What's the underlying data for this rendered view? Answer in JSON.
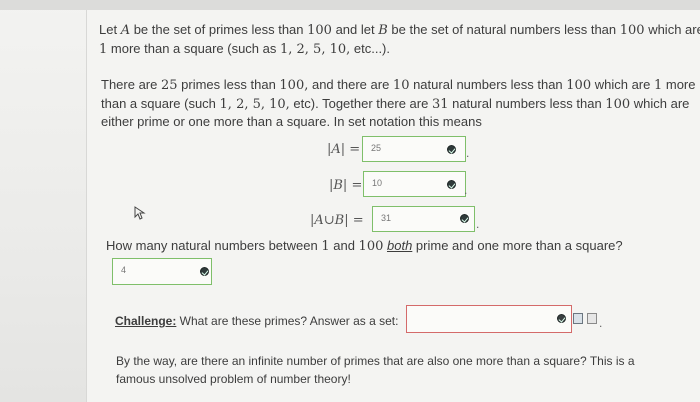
{
  "intro": {
    "line1_a": "Let ",
    "line1_A": "A",
    "line1_b": " be the set of primes less than ",
    "line1_100": "100",
    "line1_c": " and let ",
    "line1_B": "B",
    "line1_d": " be the set of natural numbers less than ",
    "line1_100b": "100",
    "line1_e": " which are",
    "line2_a": "1",
    "line2_b": " more than a square (such as ",
    "line2_list": "1, 2, 5, 10,",
    "line2_c": " etc...)."
  },
  "para": {
    "l1_a": "There are ",
    "l1_25": "25",
    "l1_b": " primes less than ",
    "l1_100": "100,",
    "l1_c": " and there are ",
    "l1_10": "10",
    "l1_d": " natural numbers less than ",
    "l1_100b": "100",
    "l1_e": " which are ",
    "l1_1": "1",
    "l1_f": " more",
    "l2_a": "than a square (such ",
    "l2_list": "1, 2, 5, 10,",
    "l2_b": " etc). Together there are ",
    "l2_31": "31",
    "l2_c": " natural numbers less than ",
    "l2_100": "100",
    "l2_d": " which are",
    "l3": "either prime or one more than a square. In set notation this means"
  },
  "answers": {
    "a_label": "|A| =",
    "a_value": "25",
    "b_label": "|B| =",
    "b_value": "10",
    "union_label": "|A∪B| =",
    "union_value": "31",
    "period": "."
  },
  "question": {
    "a": "How many natural numbers between ",
    "n1": "1",
    "b": " and ",
    "n100": "100",
    "c": " ",
    "both": "both",
    "d": " prime and one more than a square?",
    "answer": "4"
  },
  "challenge": {
    "label": "Challenge:",
    "text": " What are these primes? Answer as a set:",
    "value": ""
  },
  "footer": {
    "l1": "By the way, are there an infinite number of primes that are also one more than a square? This is a",
    "l2": "famous unsolved problem of number theory!"
  },
  "colors": {
    "correct_border": "#7fbf6a",
    "incorrect_border": "#d46a6a"
  },
  "icons": [
    "check-icon",
    "cursor-icon",
    "preview-icon",
    "help-icon"
  ]
}
